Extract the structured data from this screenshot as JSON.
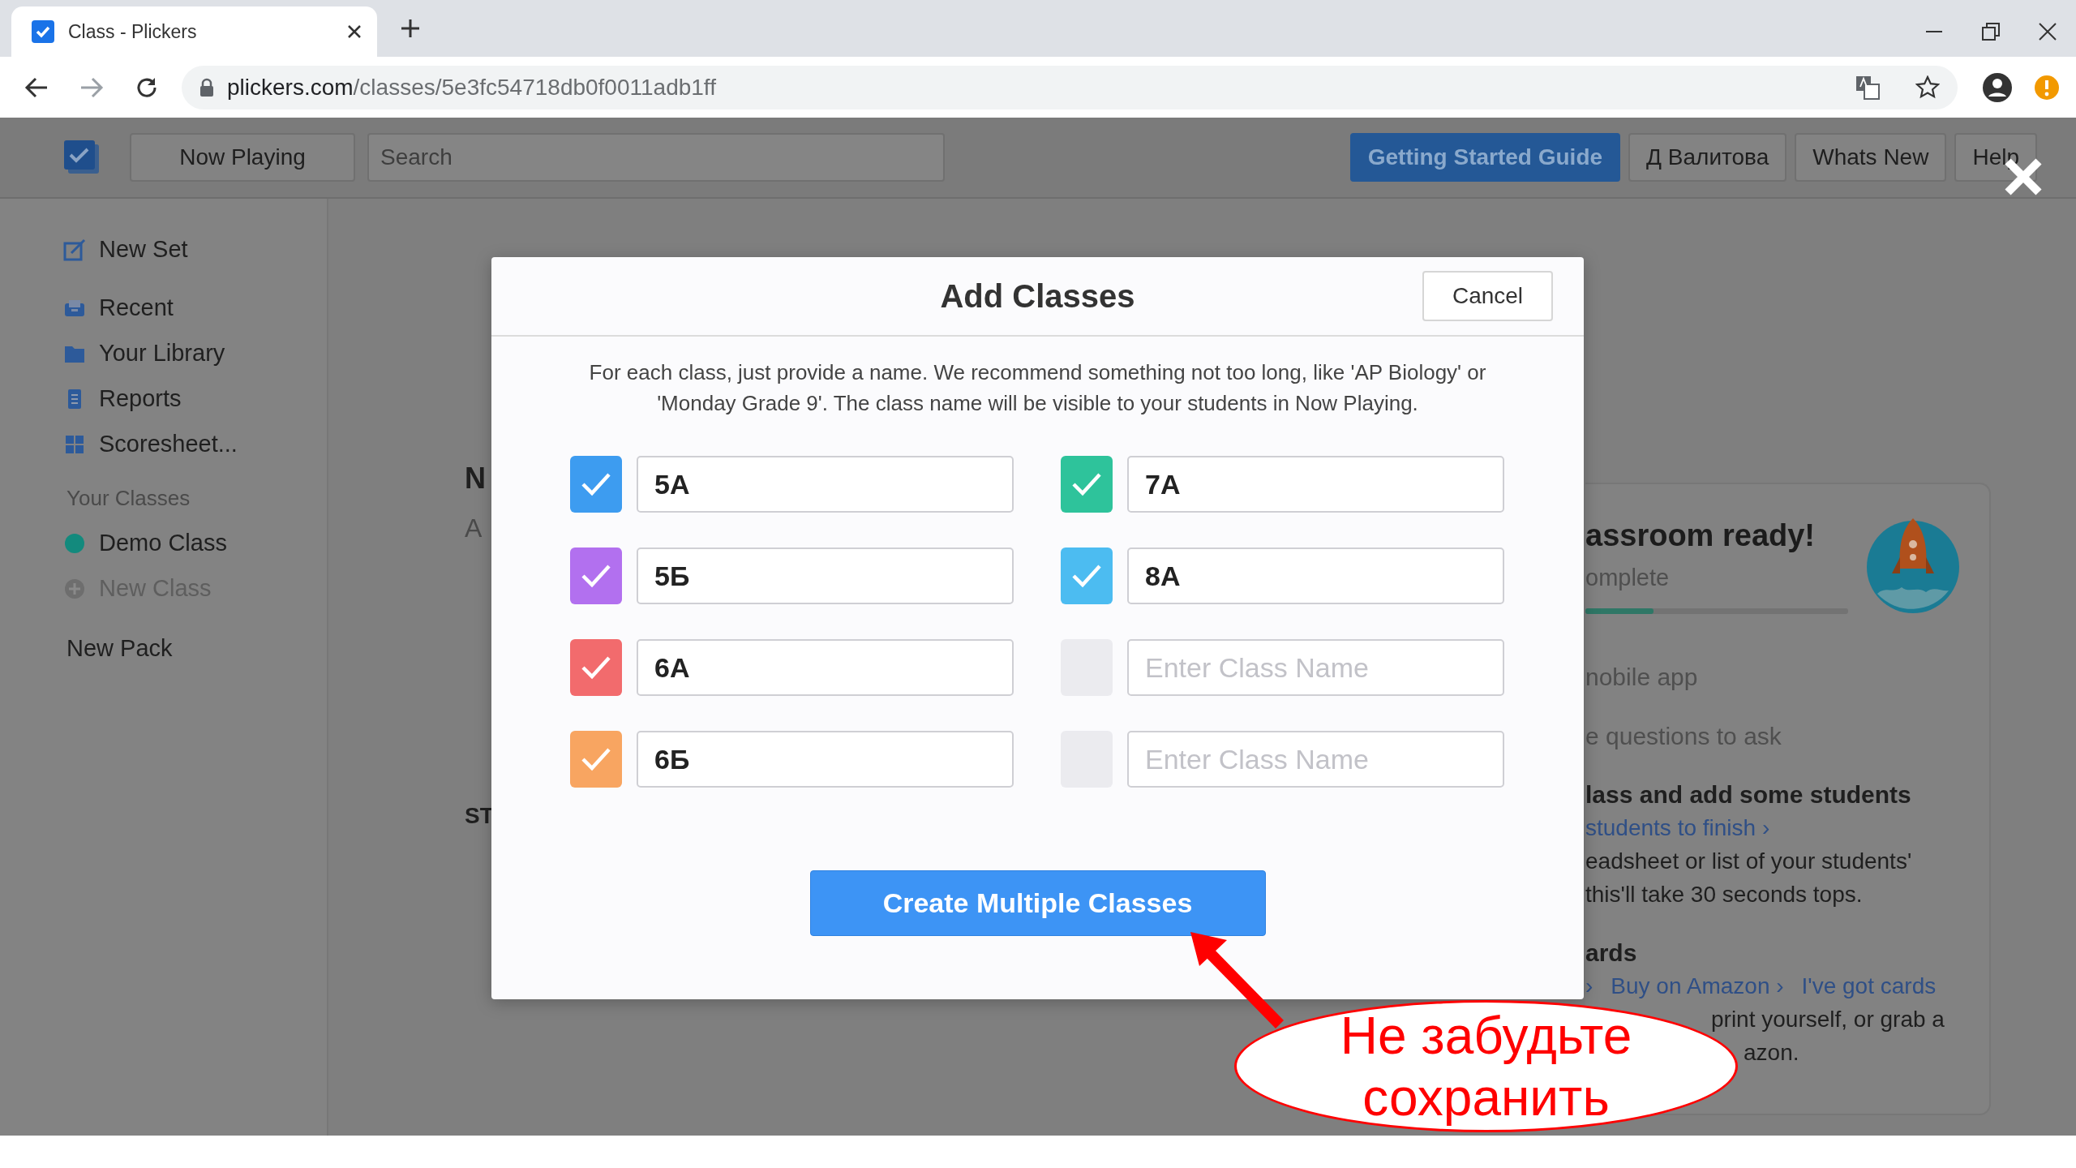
{
  "browser": {
    "tab_title": "Class - Plickers",
    "url_host": "plickers.com",
    "url_path": "/classes/5e3fc54718db0f0011adb1ff"
  },
  "topbar": {
    "now_playing": "Now Playing",
    "search_placeholder": "Search",
    "buttons": [
      {
        "label": "Getting Started Guide",
        "kind": "primary"
      },
      {
        "label": "Д Валитова",
        "kind": "plain"
      },
      {
        "label": "Whats New",
        "kind": "plain"
      },
      {
        "label": "Help",
        "kind": "plain"
      }
    ]
  },
  "sidebar": {
    "items": [
      {
        "label": "New Set",
        "kind": "compose"
      },
      {
        "label": "Recent",
        "kind": "tray"
      },
      {
        "label": "Your Library",
        "kind": "folder"
      },
      {
        "label": "Reports",
        "kind": "document"
      },
      {
        "label": "Scoresheet...",
        "kind": "grid"
      },
      {
        "label": "Your Classes",
        "kind": "heading"
      },
      {
        "label": "Demo Class",
        "kind": "class"
      },
      {
        "label": "New Class",
        "kind": "add"
      },
      {
        "label": "New Pack",
        "kind": "plain"
      }
    ]
  },
  "behind_modal": {
    "left_texts": [
      {
        "text": "N",
        "kind": "title"
      },
      {
        "text": "A",
        "kind": "subtitle"
      },
      {
        "text": "ST",
        "kind": "label"
      }
    ],
    "checklist_card": {
      "title": "assroom ready!",
      "subtitle": "omplete",
      "progress": {
        "level": 0.26
      },
      "items": [
        {
          "kind": "done",
          "text": "nobile app"
        },
        {
          "kind": "done",
          "text": "e questions to ask"
        },
        {
          "kind": "heading",
          "text": "lass and add some students"
        },
        {
          "kind": "link",
          "text": "students to finish ›"
        },
        {
          "kind": "text",
          "text": "eadsheet or list of your students'"
        },
        {
          "kind": "text",
          "text": "this'll take 30 seconds tops."
        },
        {
          "kind": "heading",
          "text": "ards"
        },
        {
          "kind": "links",
          "links": [
            "›",
            "Buy on Amazon ›",
            "I've got cards"
          ]
        },
        {
          "kind": "text",
          "text": "print yourself, or grab a"
        },
        {
          "kind": "text",
          "text": "azon."
        }
      ]
    }
  },
  "modal": {
    "title": "Add Classes",
    "cancel": "Cancel",
    "description": "For each class, just provide a name. We recommend something not too long, like 'AP Biology' or 'Monday Grade 9'. The class name will be visible to your students in Now Playing.",
    "classes": [
      {
        "value": "5A",
        "checked": true,
        "color": "#3d9cf0"
      },
      {
        "value": "7A",
        "checked": true,
        "color": "#2ec39b"
      },
      {
        "value": "5Б",
        "checked": true,
        "color": "#b270ef"
      },
      {
        "value": "8A",
        "checked": true,
        "color": "#4cbcf1"
      },
      {
        "value": "6A",
        "checked": true,
        "color": "#f26b6d"
      },
      {
        "placeholder": "Enter Class Name",
        "checked": false
      },
      {
        "value": "6Б",
        "checked": true,
        "color": "#f8a561"
      },
      {
        "placeholder": "Enter Class Name",
        "checked": false
      }
    ],
    "submit": "Create Multiple Classes"
  },
  "callout": {
    "text": "Не забудьте сохранить"
  }
}
